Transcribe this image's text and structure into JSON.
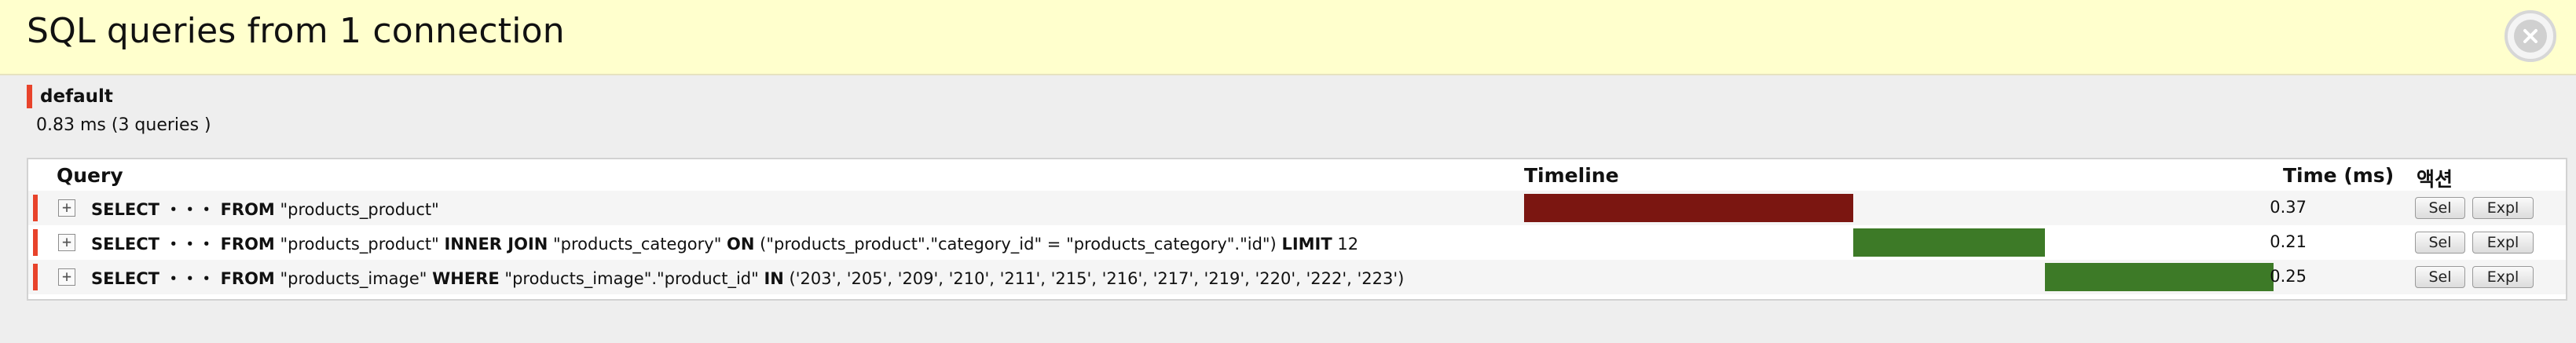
{
  "header": {
    "title": "SQL queries from 1 connection"
  },
  "connection": {
    "name": "default",
    "summary": "0.83 ms (3 queries )"
  },
  "table": {
    "columns": {
      "query": "Query",
      "timeline": "Timeline",
      "time": "Time (ms)",
      "actions": "액션"
    },
    "rows": [
      {
        "select_kw": "SELECT",
        "ellipsis": "・・・",
        "from_kw": "FROM",
        "tail": [
          {
            "text": " \"products_product\"",
            "kw": false
          }
        ],
        "time": "0.37",
        "timeline": {
          "start_pct": 0.0,
          "width_pct": 44.6
        },
        "bar_color": "#7b1611",
        "sel_label": "Sel",
        "expl_label": "Expl"
      },
      {
        "select_kw": "SELECT",
        "ellipsis": "・・・",
        "from_kw": "FROM",
        "tail": [
          {
            "text": " \"products_product\" ",
            "kw": false
          },
          {
            "text": "INNER JOIN",
            "kw": true
          },
          {
            "text": " \"products_category\" ",
            "kw": false
          },
          {
            "text": "ON",
            "kw": true
          },
          {
            "text": " (\"products_product\".\"category_id\" = \"products_category\".\"id\") ",
            "kw": false
          },
          {
            "text": "LIMIT",
            "kw": true
          },
          {
            "text": " 12",
            "kw": false
          }
        ],
        "time": "0.21",
        "timeline": {
          "start_pct": 44.6,
          "width_pct": 25.9
        },
        "bar_color": "#3d7a27",
        "sel_label": "Sel",
        "expl_label": "Expl"
      },
      {
        "select_kw": "SELECT",
        "ellipsis": "・・・",
        "from_kw": "FROM",
        "tail": [
          {
            "text": " \"products_image\" ",
            "kw": false
          },
          {
            "text": "WHERE",
            "kw": true
          },
          {
            "text": " \"products_image\".\"product_id\" ",
            "kw": false
          },
          {
            "text": "IN",
            "kw": true
          },
          {
            "text": " ('203', '205', '209', '210', '211', '215', '216', '217', '219', '220', '222', '223')",
            "kw": false
          }
        ],
        "time": "0.25",
        "timeline": {
          "start_pct": 70.5,
          "width_pct": 31.0
        },
        "bar_color": "#3d7a27",
        "sel_label": "Sel",
        "expl_label": "Expl"
      }
    ]
  },
  "colors": {
    "accent": "#e8432b",
    "header_bg": "#ffffcd"
  }
}
